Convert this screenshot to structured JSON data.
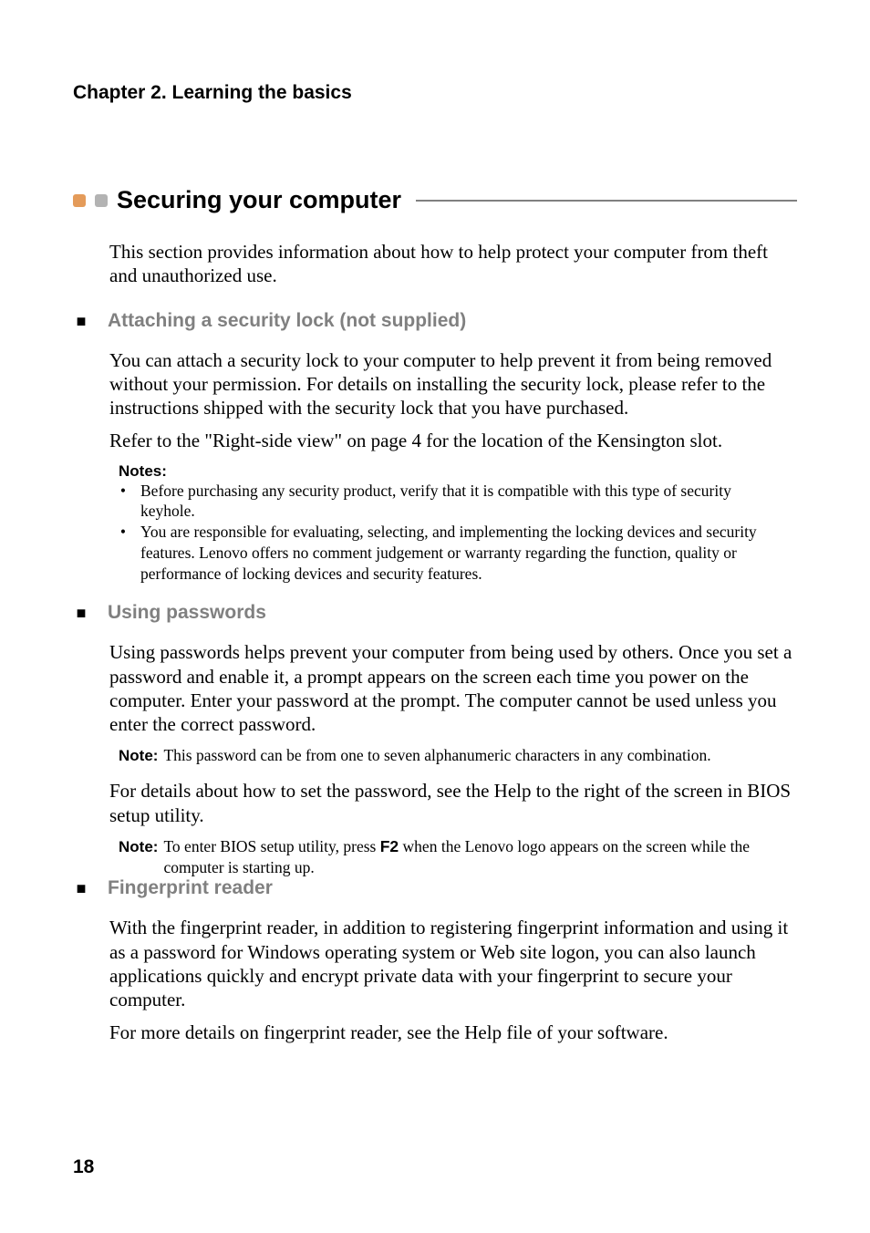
{
  "chapter_header": "Chapter 2. Learning the basics",
  "section": {
    "title": "Securing your computer",
    "intro": "This section provides information about how to help protect your computer from theft and unauthorized use."
  },
  "sub1": {
    "title": "Attaching a security lock (not supplied)",
    "p1": "You can attach a security lock to your computer to help prevent it from being removed without your permission. For details on installing the security lock, please refer to the instructions shipped with the security lock that you have purchased.",
    "p2": "Refer to the \"Right-side view\" on page 4 for the location of the Kensington slot.",
    "notes_label": "Notes:",
    "note1": "Before purchasing any security product, verify that it is compatible with this type of security keyhole.",
    "note2": "You are responsible for evaluating, selecting, and implementing the locking devices and security features. Lenovo offers no comment judgement or warranty regarding the function, quality or performance of locking devices and security features."
  },
  "sub2": {
    "title": "Using passwords",
    "p1": "Using passwords helps prevent your computer from being used by others. Once you set a password and enable it, a prompt appears on the screen each time you power on the computer. Enter your password at the prompt. The computer cannot be used unless you enter the correct password.",
    "note1_label": "Note:",
    "note1": "This password can be from one to seven alphanumeric characters in any combination.",
    "p2": "For details about how to set the password, see the Help to the right of the screen in BIOS setup utility.",
    "note2_label": "Note:",
    "note2a": "To enter BIOS setup utility, press ",
    "note2_key": "F2",
    "note2b": " when the Lenovo logo appears on the screen while the computer is starting up."
  },
  "sub3": {
    "title": "Fingerprint reader",
    "p1": "With the fingerprint reader, in addition to registering fingerprint information and using it as a password for Windows operating system or Web site logon, you can also launch applications quickly and encrypt private data with your fingerprint to secure your computer.",
    "p2": "For more details on fingerprint reader, see the Help file of your software."
  },
  "page_number": "18"
}
